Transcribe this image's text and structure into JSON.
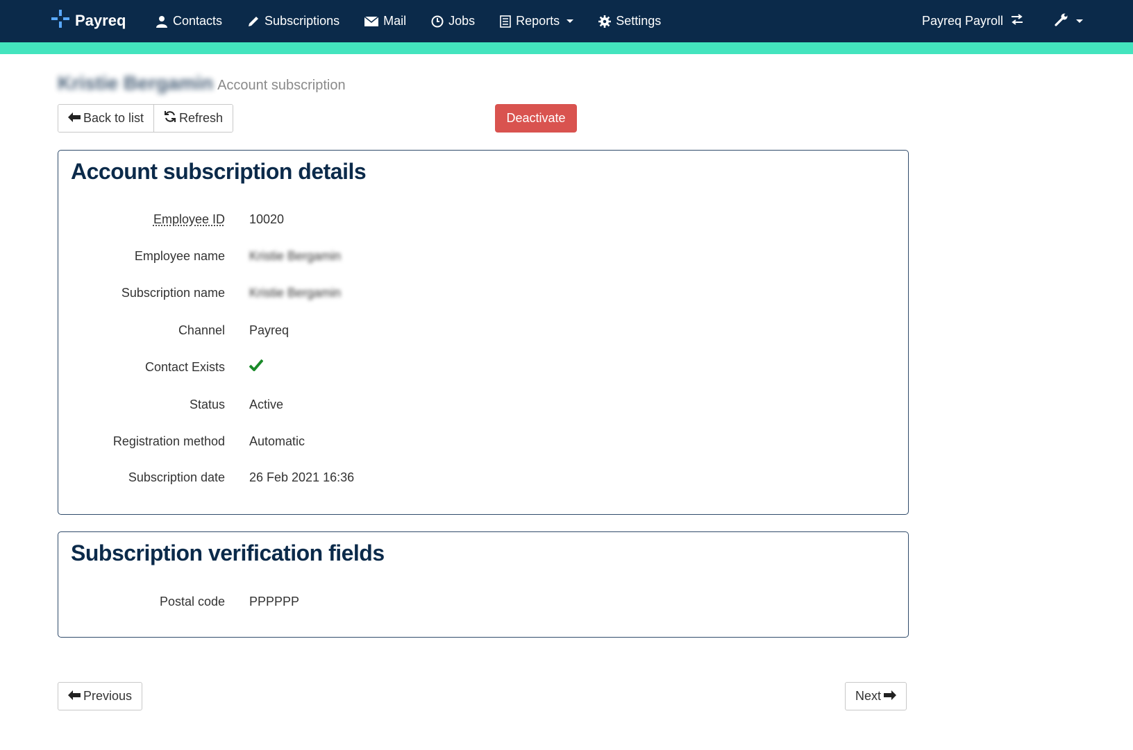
{
  "nav": {
    "brand": "Payreq",
    "items": [
      {
        "label": "Contacts",
        "icon": "user-icon"
      },
      {
        "label": "Subscriptions",
        "icon": "pencil-icon"
      },
      {
        "label": "Mail",
        "icon": "envelope-icon"
      },
      {
        "label": "Jobs",
        "icon": "clock-icon"
      },
      {
        "label": "Reports",
        "icon": "list-icon",
        "dropdown": true
      },
      {
        "label": "Settings",
        "icon": "gear-icon"
      }
    ],
    "org": "Payreq Payroll",
    "accent_color": "#43e4be",
    "bar_color": "#0b2a4a"
  },
  "header": {
    "name": "Kristie Bergamin",
    "subtitle": "Account subscription"
  },
  "toolbar": {
    "back_label": "Back to list",
    "refresh_label": "Refresh",
    "deactivate_label": "Deactivate"
  },
  "details": {
    "title": "Account subscription details",
    "employee_id_label": "Employee ID",
    "employee_id": "10020",
    "employee_name_label": "Employee name",
    "employee_name": "Kristie Bergamin",
    "subscription_name_label": "Subscription name",
    "subscription_name": "Kristie Bergamin",
    "channel_label": "Channel",
    "channel": "Payreq",
    "contact_exists_label": "Contact Exists",
    "contact_exists": true,
    "status_label": "Status",
    "status": "Active",
    "registration_method_label": "Registration method",
    "registration_method": "Automatic",
    "subscription_date_label": "Subscription date",
    "subscription_date": "26 Feb 2021 16:36"
  },
  "verification": {
    "title": "Subscription verification fields",
    "postal_code_label": "Postal code",
    "postal_code": "PPPPPP"
  },
  "pager": {
    "previous_label": "Previous",
    "next_label": "Next"
  }
}
